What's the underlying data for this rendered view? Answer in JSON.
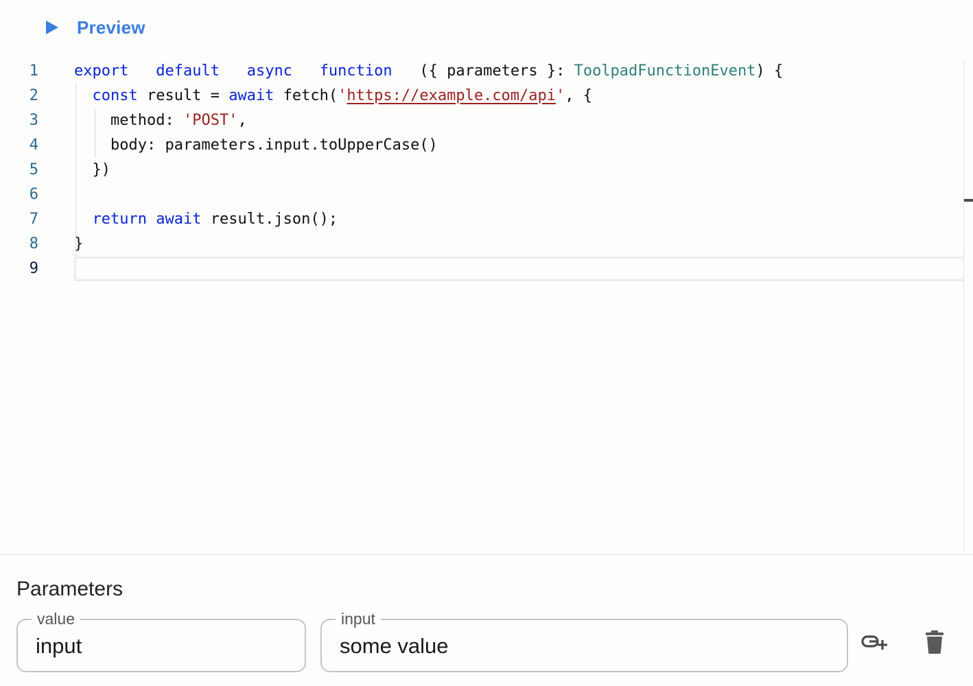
{
  "toolbar": {
    "preview_label": "Preview",
    "accent_color": "#3d7ce0",
    "preview_icon": "play-icon"
  },
  "editor": {
    "line_numbers": [
      "1",
      "2",
      "3",
      "4",
      "5",
      "6",
      "7",
      "8",
      "9"
    ],
    "active_line": 9,
    "lines": [
      [
        [
          "kw",
          "export"
        ],
        [
          "",
          "   "
        ],
        [
          "kw",
          "default"
        ],
        [
          "",
          "   "
        ],
        [
          "kw",
          "async"
        ],
        [
          "",
          "   "
        ],
        [
          "kw",
          "function"
        ],
        [
          "",
          "   "
        ],
        [
          "",
          "({ parameters }: "
        ],
        [
          "ty",
          "ToolpadFunctionEvent"
        ],
        [
          "",
          ") {"
        ]
      ],
      [
        [
          "",
          "  "
        ],
        [
          "kw",
          "const"
        ],
        [
          "",
          " result = "
        ],
        [
          "kw",
          "await"
        ],
        [
          "",
          " fetch("
        ],
        [
          "str",
          "'"
        ],
        [
          "url",
          "https://example.com/api"
        ],
        [
          "str",
          "'"
        ],
        [
          "",
          ", {"
        ]
      ],
      [
        [
          "",
          "    method: "
        ],
        [
          "str",
          "'POST'"
        ],
        [
          "",
          ","
        ]
      ],
      [
        [
          "",
          "    body: parameters.input.toUpperCase()"
        ]
      ],
      [
        [
          "",
          "  })"
        ]
      ],
      [
        [
          "",
          ""
        ]
      ],
      [
        [
          "",
          "  "
        ],
        [
          "kw",
          "return"
        ],
        [
          "",
          " "
        ],
        [
          "kw",
          "await"
        ],
        [
          "",
          " result.json();"
        ]
      ],
      [
        [
          "",
          "}"
        ]
      ],
      [
        [
          "",
          ""
        ]
      ]
    ],
    "colors": {
      "keyword": "#0b24d6",
      "type": "#2f7f7a",
      "string": "#9b1f1f",
      "line_number": "#2d6a8f"
    }
  },
  "parameters": {
    "title": "Parameters",
    "name_field": {
      "label": "value",
      "value": "input"
    },
    "value_field": {
      "label": "input",
      "value": "some value"
    },
    "bind_icon": "add-link-icon",
    "delete_icon": "trash-icon"
  }
}
